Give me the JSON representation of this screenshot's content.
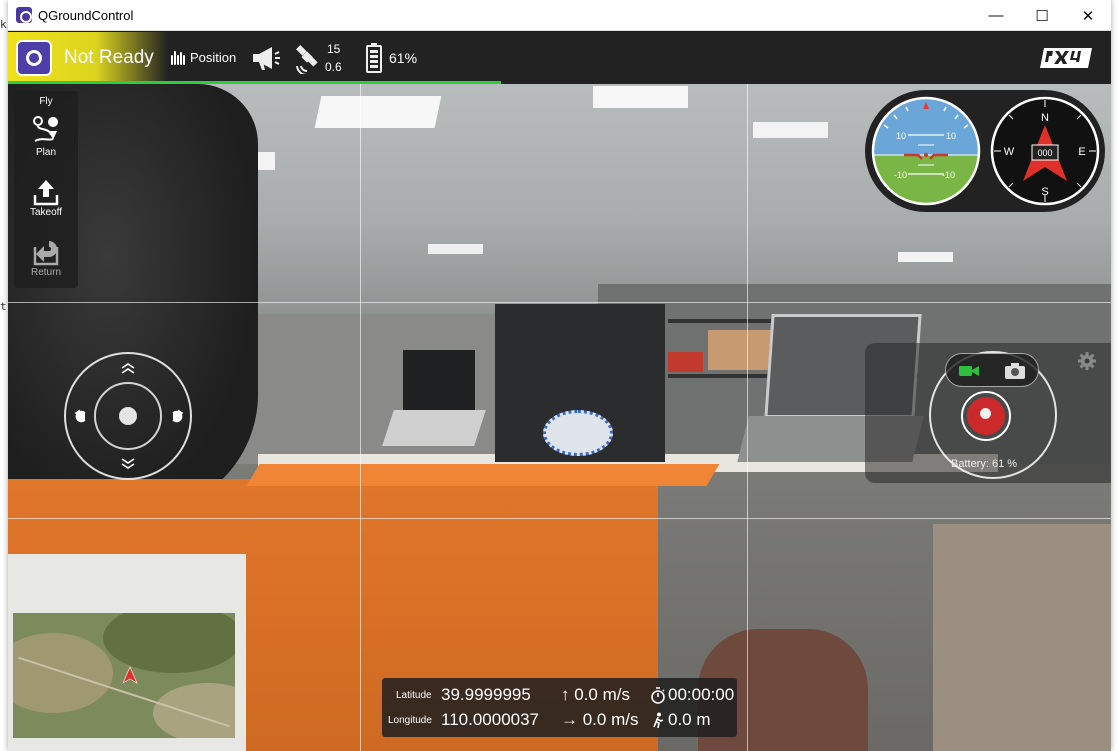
{
  "window": {
    "title": "QGroundControl",
    "minimize": "—",
    "maximize": "☐",
    "close": "✕"
  },
  "toolbar": {
    "status": "Not Ready",
    "flight_mode": "Position",
    "gps_count": "15",
    "gps_hdop": "0.6",
    "battery": "61%",
    "ready_color": "#e6dc1c",
    "progress_color": "#2ecc40"
  },
  "toolstrip": {
    "header": "Fly",
    "items": [
      {
        "label": "Plan",
        "icon": "plan-icon"
      },
      {
        "label": "Takeoff",
        "icon": "takeoff-icon"
      },
      {
        "label": "Return",
        "icon": "return-icon"
      }
    ]
  },
  "attitude": {
    "pitch_upper_left": "10",
    "pitch_upper_right": "10",
    "pitch_lower_left": "-10",
    "pitch_lower_right": "-10"
  },
  "compass": {
    "n": "N",
    "s": "S",
    "e": "E",
    "w": "W",
    "heading": "000"
  },
  "camera": {
    "battery_label": "Battery: 61 %"
  },
  "telemetry": {
    "latitude_label": "Latitude",
    "latitude": "39.9999995",
    "longitude_label": "Longitude",
    "longitude": "110.0000037",
    "vertical_speed": "↑ 0.0 m/s",
    "horizontal_speed": "→ 0.0 m/s",
    "flight_time": "00:00:00",
    "distance": "0.0 m"
  }
}
